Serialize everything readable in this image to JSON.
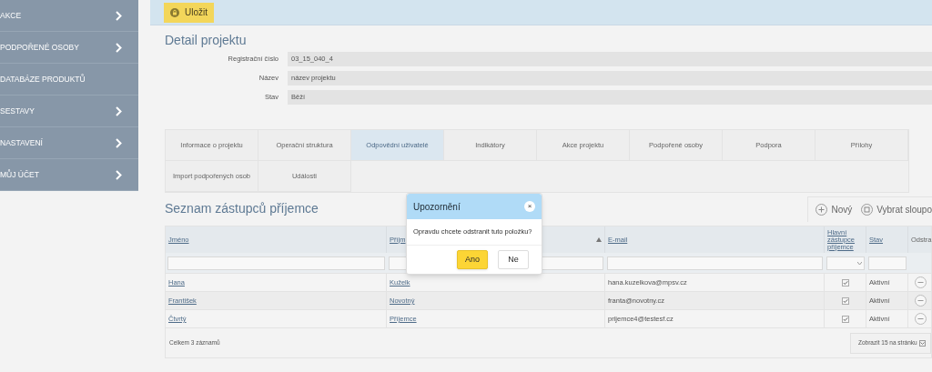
{
  "sidebar": {
    "items": [
      {
        "label": "AKCE",
        "has_submenu": true
      },
      {
        "label": "PODPOŘENÉ OSOBY",
        "has_submenu": true
      },
      {
        "label": "DATABÁZE PRODUKTŮ",
        "has_submenu": false
      },
      {
        "label": "SESTAVY",
        "has_submenu": true
      },
      {
        "label": "NASTAVENÍ",
        "has_submenu": true
      },
      {
        "label": "MŮJ ÚČET",
        "has_submenu": true
      }
    ]
  },
  "toolbar": {
    "save_button": "Uložit"
  },
  "detail": {
    "title": "Detail projektu",
    "fields": [
      {
        "label": "Registrační číslo",
        "value": "03_15_040_4"
      },
      {
        "label": "Název",
        "value": "název projektu"
      },
      {
        "label": "Stav",
        "value": "Běží"
      }
    ]
  },
  "tabs": [
    {
      "label": "Informace o projektu",
      "selected": false
    },
    {
      "label": "Operační struktura",
      "selected": false
    },
    {
      "label": "Odpovědní uživatelé",
      "selected": true
    },
    {
      "label": "Indikátory",
      "selected": false
    },
    {
      "label": "Akce projektu",
      "selected": false
    },
    {
      "label": "Podpořené osoby",
      "selected": false
    },
    {
      "label": "Podpora",
      "selected": false
    },
    {
      "label": "Přílohy",
      "selected": false
    },
    {
      "label": "Import podpořených osob",
      "selected": false
    },
    {
      "label": "Události",
      "selected": false
    }
  ],
  "list": {
    "title": "Seznam zástupců příjemce",
    "new_button": "Nový",
    "columns_button": "Vybrat sloupo",
    "table": {
      "columns": [
        {
          "label": "Jméno",
          "kind": "text"
        },
        {
          "label": "Příjm",
          "kind": "text",
          "sorted": true
        },
        {
          "label": "E-mail",
          "kind": "text"
        },
        {
          "label": "Hlavní zástupce příjemce",
          "kind": "select"
        },
        {
          "label": "Stav",
          "kind": "text"
        },
        {
          "label": "Odstra",
          "kind": "none"
        }
      ],
      "rows": [
        {
          "first_name": "Hana",
          "last_name": "Kuželk",
          "email": "hana.kuzelkova@mpsv.cz",
          "main": true,
          "status": "Aktivní"
        },
        {
          "first_name": "František",
          "last_name": "Novotný",
          "email": "franta@novotny.cz",
          "main": true,
          "status": "Aktivní"
        },
        {
          "first_name": "Čtvrtý",
          "last_name": "Příjemce",
          "email": "prijemce4@testesf.cz",
          "main": true,
          "status": "Aktivní"
        }
      ],
      "total": "Celkem 3 záznamů",
      "page_size": "Zobrazit 15 na stránku"
    }
  },
  "dialog": {
    "title": "Upozornění",
    "close": "×",
    "message": "Opravdu chcete odstranit tuto položku?",
    "buttons": [
      {
        "label": "Ano",
        "kind": "primary"
      },
      {
        "label": "Ne",
        "kind": "secondary"
      }
    ]
  }
}
